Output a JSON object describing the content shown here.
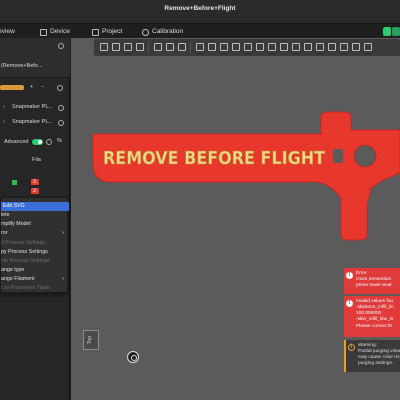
{
  "window": {
    "title": "Remove+Before+Flight"
  },
  "tabs": [
    {
      "label": "review"
    },
    {
      "label": "Device"
    },
    {
      "label": "Project"
    },
    {
      "label": "Calibration"
    }
  ],
  "left_panel": {
    "object_name": "(Remove+Befo...",
    "printer_1": "Snapmaker PL...",
    "printer_2": "Snapmaker PL...",
    "advanced_label": "Advanced",
    "percent_icon": "%",
    "plus": "+",
    "minus": "−",
    "fila_header": "Fila",
    "badge_1": "3",
    "badge_2": "3"
  },
  "context_menu": {
    "items": [
      {
        "label": "Edit SVG",
        "state": "highlighted",
        "arrow": ""
      },
      {
        "label": "lete",
        "state": "normal",
        "arrow": ""
      },
      {
        "label": "mplify Model",
        "state": "normal",
        "arrow": ""
      },
      {
        "label": "ror",
        "state": "normal",
        "arrow": "›"
      },
      {
        "label": "d Process Settings",
        "state": "disabled",
        "arrow": ""
      },
      {
        "label": "py Process Settings",
        "state": "normal",
        "arrow": ""
      },
      {
        "label": "ste Process Settings",
        "state": "disabled",
        "arrow": ""
      },
      {
        "label": "ange type",
        "state": "normal",
        "arrow": ""
      },
      {
        "label": "ange Filament",
        "state": "normal",
        "arrow": "›"
      },
      {
        "label": "t as Parameter Table",
        "state": "disabled",
        "arrow": ""
      }
    ]
  },
  "model": {
    "text": "REMOVE BEFORE FLIGHT",
    "color": "#e8372c",
    "text_color": "#f1d88a"
  },
  "view_cube_label": "Top",
  "notifications": [
    {
      "type": "error",
      "icon": "!",
      "lines": [
        "Error",
        "Ooze prevention",
        "prime tower enal"
      ]
    },
    {
      "type": "error",
      "icon": "!",
      "lines": [
        "Invalid values fou",
        "-skeleton_infill_lin",
        "100.000000",
        "-skin_infill_line_w",
        "",
        "Please correct th"
      ]
    },
    {
      "type": "warning",
      "icon": "!",
      "lines": [
        "Warning:",
        "Partial purging volum",
        "may cause color mixin",
        "purging settings."
      ]
    }
  ],
  "colors": {
    "accent": "#3a6fd8",
    "error": "#e03b3b",
    "success": "#2ecc71",
    "warning": "#e0a030"
  }
}
